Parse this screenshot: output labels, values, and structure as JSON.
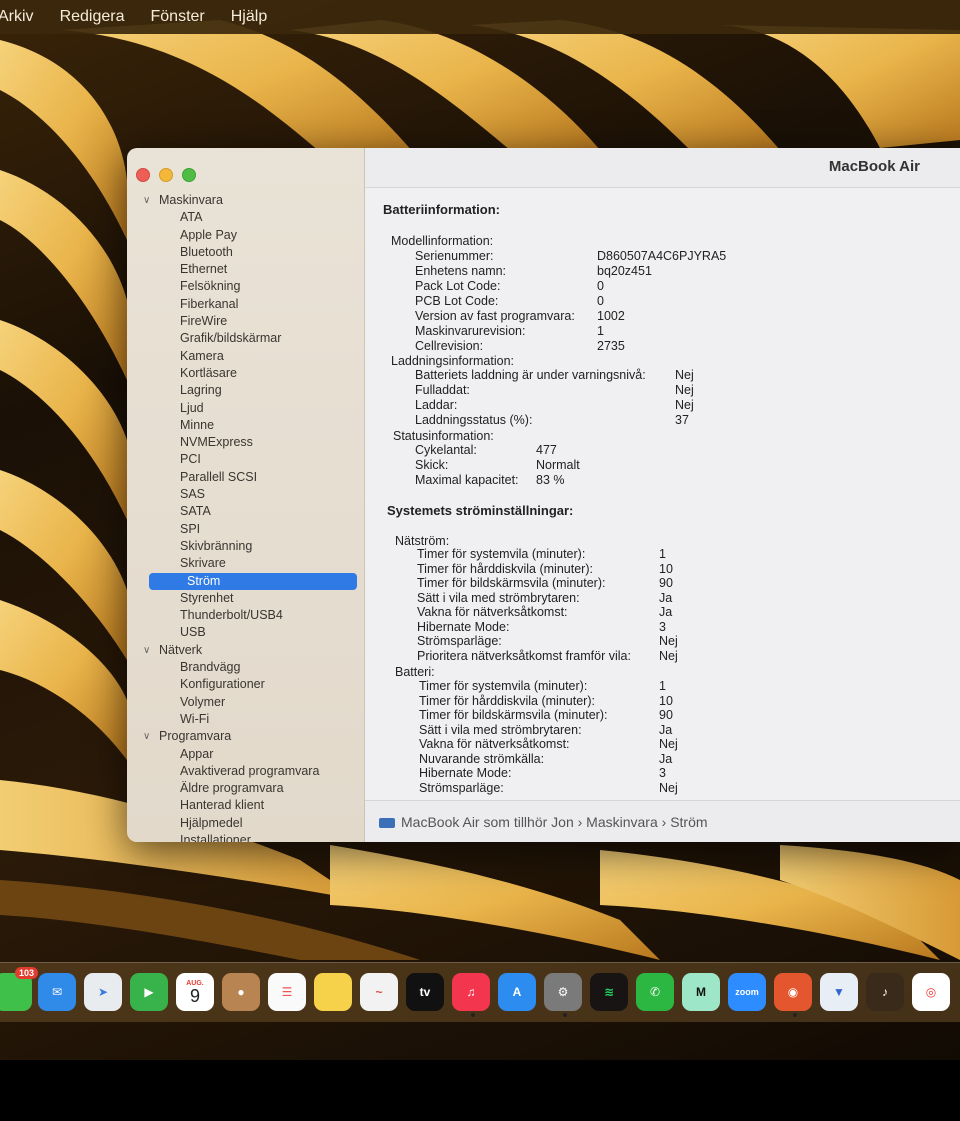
{
  "menubar": {
    "items": [
      "Arkiv",
      "Redigera",
      "Fönster",
      "Hjälp"
    ]
  },
  "window": {
    "title": "MacBook Air"
  },
  "sidebar": {
    "groups": [
      {
        "label": "Maskinvara",
        "items": [
          "ATA",
          "Apple Pay",
          "Bluetooth",
          "Ethernet",
          "Felsökning",
          "Fiberkanal",
          "FireWire",
          "Grafik/bildskärmar",
          "Kamera",
          "Kortläsare",
          "Lagring",
          "Ljud",
          "Minne",
          "NVMExpress",
          "PCI",
          "Parallell SCSI",
          "SAS",
          "SATA",
          "SPI",
          "Skivbränning",
          "Skrivare",
          "Ström",
          "Styrenhet",
          "Thunderbolt/USB4",
          "USB"
        ]
      },
      {
        "label": "Nätverk",
        "items": [
          "Brandvägg",
          "Konfigurationer",
          "Volymer",
          "Wi-Fi"
        ]
      },
      {
        "label": "Programvara",
        "items": [
          "Appar",
          "Avaktiverad programvara",
          "Äldre programvara",
          "Hanterad klient",
          "Hjälpmedel",
          "Installationer"
        ]
      }
    ],
    "selected": "Ström"
  },
  "battery_info": {
    "title": "Batteriinformation:",
    "model_header": "Modellinformation:",
    "model": [
      {
        "label": "Serienummer:",
        "value": "D860507A4C6PJYRA5"
      },
      {
        "label": "Enhetens namn:",
        "value": "bq20z451"
      },
      {
        "label": "Pack Lot Code:",
        "value": "0"
      },
      {
        "label": "PCB Lot Code:",
        "value": "0"
      },
      {
        "label": "Version av fast programvara:",
        "value": "1002"
      },
      {
        "label": "Maskinvarurevision:",
        "value": "1"
      },
      {
        "label": "Cellrevision:",
        "value": "2735"
      }
    ],
    "charge_header": "Laddningsinformation:",
    "charge": [
      {
        "label": "Batteriets laddning är under varningsnivå:",
        "value": "Nej"
      },
      {
        "label": "Fulladdat:",
        "value": "Nej"
      },
      {
        "label": "Laddar:",
        "value": "Nej"
      },
      {
        "label": "Laddningsstatus (%):",
        "value": "37"
      }
    ],
    "status_header": "Statusinformation:",
    "status": [
      {
        "label": "Cykelantal:",
        "value": "477"
      },
      {
        "label": "Skick:",
        "value": "Normalt"
      },
      {
        "label": "Maximal kapacitet:",
        "value": "83 %"
      }
    ]
  },
  "power_settings": {
    "title": "Systemets ströminställningar:",
    "ac_header": "Nätström:",
    "ac": [
      {
        "label": "Timer för systemvila (minuter):",
        "value": "1"
      },
      {
        "label": "Timer för hårddiskvila (minuter):",
        "value": "10"
      },
      {
        "label": "Timer för bildskärmsvila (minuter):",
        "value": "90"
      },
      {
        "label": "Sätt i vila med strömbrytaren:",
        "value": "Ja"
      },
      {
        "label": "Vakna för nätverksåtkomst:",
        "value": "Ja"
      },
      {
        "label": "Hibernate Mode:",
        "value": "3"
      },
      {
        "label": "Strömsparläge:",
        "value": "Nej"
      },
      {
        "label": "Prioritera nätverksåtkomst framför vila:",
        "value": "Nej"
      }
    ],
    "battery_header": "Batteri:",
    "battery": [
      {
        "label": "Timer för systemvila (minuter):",
        "value": "1"
      },
      {
        "label": "Timer för hårddiskvila (minuter):",
        "value": "10"
      },
      {
        "label": "Timer för bildskärmsvila (minuter):",
        "value": "90"
      },
      {
        "label": "Sätt i vila med strömbrytaren:",
        "value": "Ja"
      },
      {
        "label": "Vakna för nätverksåtkomst:",
        "value": "Nej"
      },
      {
        "label": "Nuvarande strömkälla:",
        "value": "Ja"
      },
      {
        "label": "Hibernate Mode:",
        "value": "3"
      },
      {
        "label": "Strömsparläge:",
        "value": "Nej"
      }
    ]
  },
  "pathbar": {
    "text": "MacBook Air som tillhör Jon › Maskinvara › Ström"
  },
  "dock": {
    "messages_badge": "103",
    "calendar_month": "AUG.",
    "calendar_day": "9",
    "tv_label": "tv",
    "zoom_label": "zoom"
  },
  "colors": {
    "selection": "#2f7ae5",
    "sidebar_bg": "#e6ded2",
    "main_bg": "#f0f0f2"
  }
}
